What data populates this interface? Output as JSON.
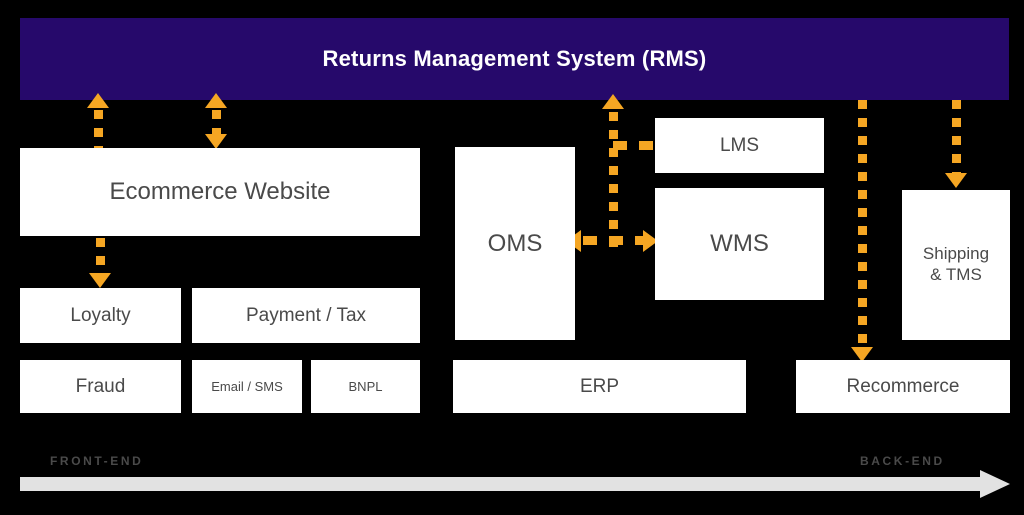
{
  "colors": {
    "banner_bg": "#26096B",
    "banner_text": "#FFFFFF",
    "box_bg": "#FFFFFF",
    "box_text": "#4A4A4A",
    "connector": "#F5A623",
    "canvas_bg": "#000000",
    "axis_bar": "#E2E2E2",
    "axis_label": "#4A4A4A"
  },
  "banner": {
    "title": "Returns Management System (RMS)"
  },
  "frontend": {
    "ecommerce": "Ecommerce Website",
    "loyalty": "Loyalty",
    "payment": "Payment / Tax",
    "fraud": "Fraud",
    "email_sms": "Email / SMS",
    "bnpl": "BNPL"
  },
  "backend": {
    "oms": "OMS",
    "lms": "LMS",
    "wms": "WMS",
    "shipping": "Shipping\n& TMS",
    "shipping_line1": "Shipping",
    "shipping_line2": "& TMS",
    "erp": "ERP",
    "recommerce": "Recommerce"
  },
  "axis": {
    "left_label": "FRONT-END",
    "right_label": "BACK-END"
  },
  "connectors": [
    {
      "id": "rms-to-ecommerce-up",
      "from": "Ecommerce Website",
      "to": "Returns Management System (RMS)",
      "direction": "up"
    },
    {
      "id": "rms-ecommerce-bidirectional",
      "from": "Returns Management System (RMS)",
      "to": "Ecommerce Website",
      "direction": "both"
    },
    {
      "id": "ecommerce-to-loyalty",
      "from": "Ecommerce Website",
      "to": "Loyalty",
      "direction": "down"
    },
    {
      "id": "oms-wms-bidirectional",
      "from": "OMS",
      "to": "WMS",
      "direction": "both"
    },
    {
      "id": "oms-wms-to-rms",
      "from": "OMS / WMS",
      "to": "Returns Management System (RMS)",
      "direction": "up"
    },
    {
      "id": "branch-to-lms",
      "from": "trunk",
      "to": "LMS",
      "direction": "right"
    },
    {
      "id": "rms-to-recommerce",
      "from": "Returns Management System (RMS)",
      "to": "Recommerce",
      "direction": "down"
    },
    {
      "id": "rms-to-shipping",
      "from": "Returns Management System (RMS)",
      "to": "Shipping & TMS",
      "direction": "down"
    }
  ]
}
